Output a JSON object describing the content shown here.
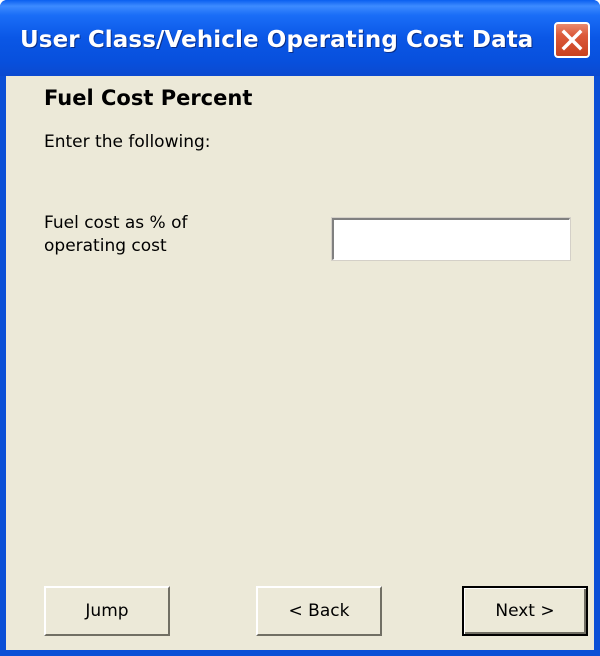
{
  "window": {
    "title": "User Class/Vehicle Operating Cost Data",
    "close_icon": "close-icon"
  },
  "page": {
    "heading": "Fuel Cost Percent",
    "instruction": "Enter the following:"
  },
  "fields": {
    "fuel_cost": {
      "label_line1": "Fuel cost as % of",
      "label_line2": "operating cost",
      "value": ""
    }
  },
  "buttons": {
    "jump": "Jump",
    "back": "< Back",
    "next": "Next >"
  },
  "colors": {
    "titlebar": "#0a57e6",
    "client_bg": "#ece9d8",
    "close_button": "#dc5a3a"
  }
}
